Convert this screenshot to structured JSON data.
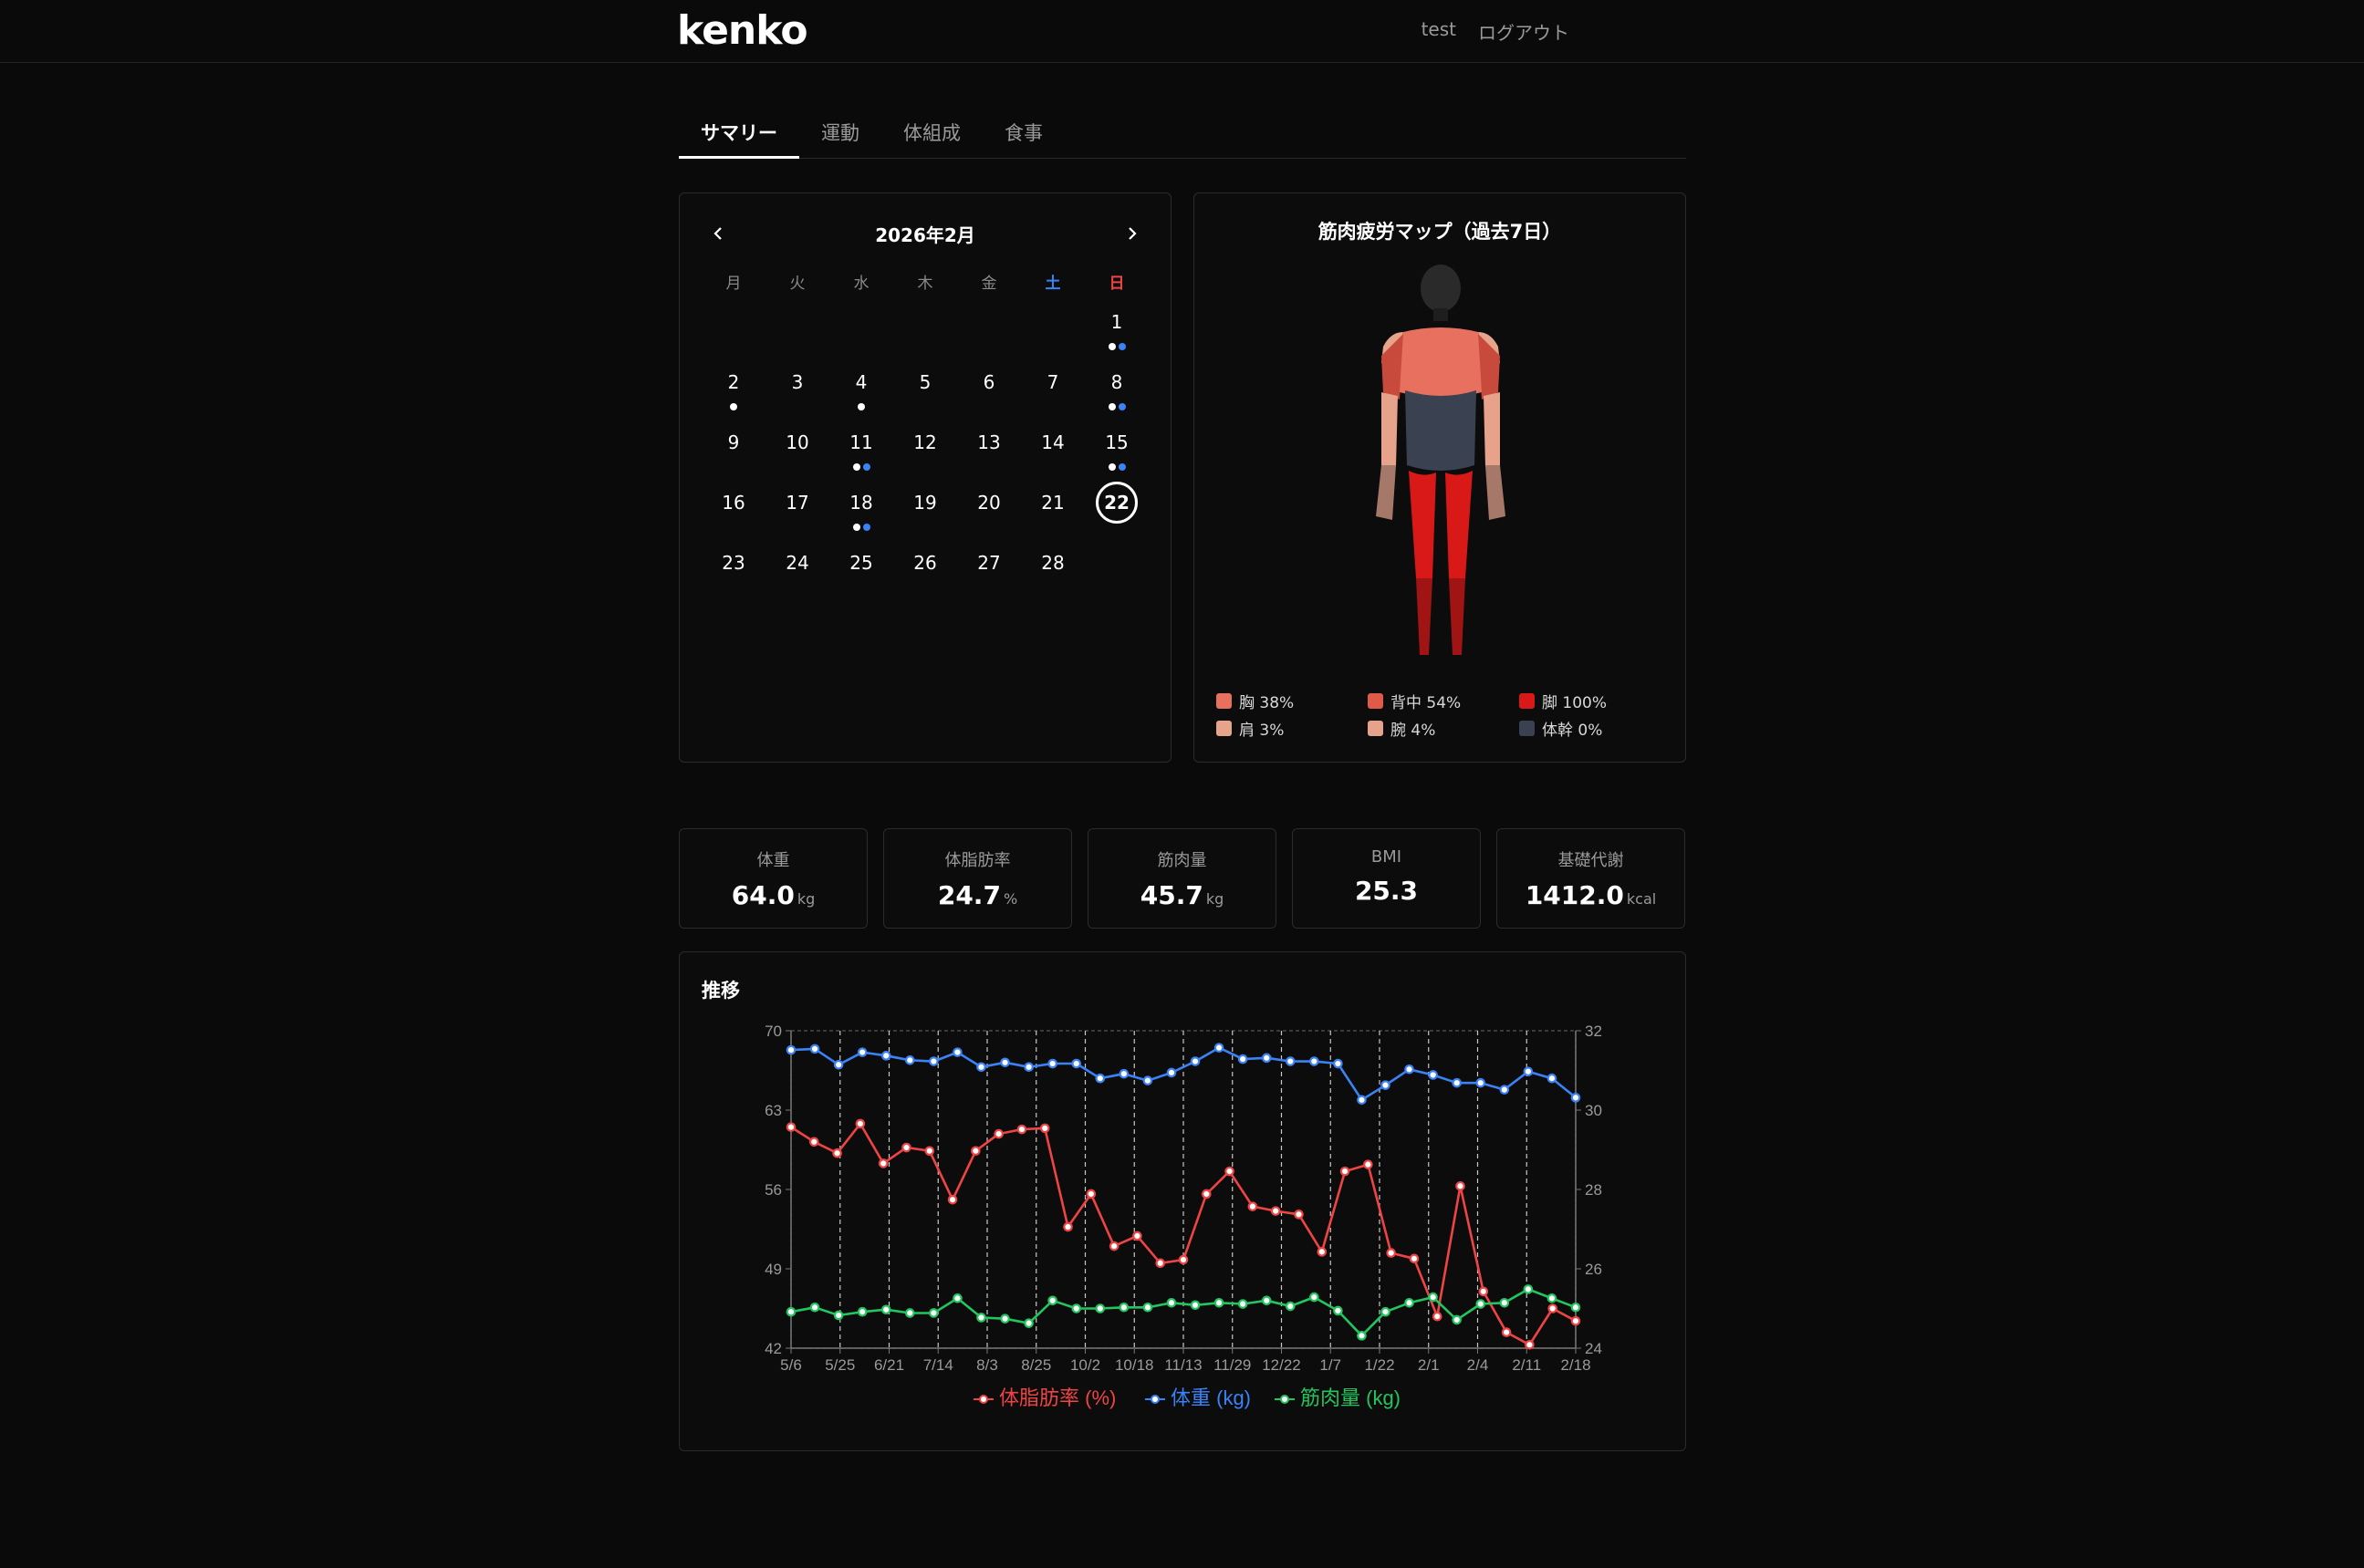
{
  "header": {
    "logo": "kenko",
    "username": "test",
    "logout_label": "ログアウト"
  },
  "tabs": [
    {
      "label": "サマリー",
      "active": true
    },
    {
      "label": "運動",
      "active": false
    },
    {
      "label": "体組成",
      "active": false
    },
    {
      "label": "食事",
      "active": false
    }
  ],
  "calendar": {
    "title": "2026年2月",
    "weekdays": [
      "月",
      "火",
      "水",
      "木",
      "金",
      "土",
      "日"
    ],
    "leading_blanks": 6,
    "days": [
      {
        "d": "1",
        "dots": [
          "white",
          "blue"
        ]
      },
      {
        "d": "2",
        "dots": [
          "white"
        ]
      },
      {
        "d": "3",
        "dots": []
      },
      {
        "d": "4",
        "dots": [
          "white"
        ]
      },
      {
        "d": "5",
        "dots": []
      },
      {
        "d": "6",
        "dots": []
      },
      {
        "d": "7",
        "dots": []
      },
      {
        "d": "8",
        "dots": [
          "white",
          "blue"
        ]
      },
      {
        "d": "9",
        "dots": []
      },
      {
        "d": "10",
        "dots": []
      },
      {
        "d": "11",
        "dots": [
          "white",
          "blue"
        ]
      },
      {
        "d": "12",
        "dots": []
      },
      {
        "d": "13",
        "dots": []
      },
      {
        "d": "14",
        "dots": []
      },
      {
        "d": "15",
        "dots": [
          "white",
          "blue"
        ]
      },
      {
        "d": "16",
        "dots": []
      },
      {
        "d": "17",
        "dots": []
      },
      {
        "d": "18",
        "dots": [
          "white",
          "blue"
        ]
      },
      {
        "d": "19",
        "dots": []
      },
      {
        "d": "20",
        "dots": []
      },
      {
        "d": "21",
        "dots": []
      },
      {
        "d": "22",
        "dots": [],
        "today": true
      },
      {
        "d": "23",
        "dots": []
      },
      {
        "d": "24",
        "dots": []
      },
      {
        "d": "25",
        "dots": []
      },
      {
        "d": "26",
        "dots": []
      },
      {
        "d": "27",
        "dots": []
      },
      {
        "d": "28",
        "dots": []
      }
    ]
  },
  "muscle_map": {
    "title": "筋肉疲労マップ（過去7日）",
    "legend": [
      {
        "label": "胸 38%",
        "color": "#e8705e"
      },
      {
        "label": "背中 54%",
        "color": "#e05a48"
      },
      {
        "label": "脚 100%",
        "color": "#d91818"
      },
      {
        "label": "肩 3%",
        "color": "#e7a48c"
      },
      {
        "label": "腕 4%",
        "color": "#e6a28a"
      },
      {
        "label": "体幹 0%",
        "color": "#3a4252"
      }
    ],
    "colors": {
      "chest": "#e8705e",
      "back": "#c84a3c",
      "legs": "#d91818",
      "shoulders": "#e7a48c",
      "arms": "#e6a28a",
      "core": "#3a4252",
      "head": "#2a2a2a"
    }
  },
  "stats": [
    {
      "label": "体重",
      "value": "64.0",
      "unit": "kg"
    },
    {
      "label": "体脂肪率",
      "value": "24.7",
      "unit": "%"
    },
    {
      "label": "筋肉量",
      "value": "45.7",
      "unit": "kg"
    },
    {
      "label": "BMI",
      "value": "25.3",
      "unit": ""
    },
    {
      "label": "基礎代謝",
      "value": "1412.0",
      "unit": "kcal"
    }
  ],
  "trend": {
    "title": "推移",
    "chart_data": {
      "type": "line",
      "x_ticks": [
        "5/6",
        "5/25",
        "6/21",
        "7/14",
        "8/3",
        "8/25",
        "10/2",
        "10/18",
        "11/13",
        "11/29",
        "12/22",
        "1/7",
        "1/22",
        "2/1",
        "2/4",
        "2/11",
        "2/18"
      ],
      "y_left": {
        "ticks": [
          "70",
          "63",
          "56",
          "49",
          "42"
        ],
        "range": [
          42,
          70
        ]
      },
      "y_right": {
        "ticks": [
          "32",
          "30",
          "28",
          "26",
          "24"
        ],
        "range": [
          24,
          32
        ]
      },
      "grid": "dashed vertical lines",
      "legend_position": "bottom",
      "series": [
        {
          "name": "体脂肪率 (%)",
          "color": "#ef4444",
          "axis": "left",
          "values": [
            61.5,
            60.2,
            59.2,
            61.8,
            58.3,
            59.7,
            59.4,
            55.1,
            59.4,
            60.9,
            61.3,
            61.4,
            52.7,
            55.6,
            51.0,
            51.9,
            49.5,
            49.8,
            55.6,
            57.6,
            54.5,
            54.1,
            53.8,
            50.5,
            57.6,
            58.2,
            50.4,
            49.9,
            44.8,
            56.3,
            47.0,
            43.4,
            42.3,
            45.5,
            44.4
          ]
        },
        {
          "name": "体重 (kg)",
          "color": "#3b82f6",
          "axis": "left",
          "values": [
            68.3,
            68.4,
            67.0,
            68.1,
            67.8,
            67.4,
            67.3,
            68.1,
            66.8,
            67.2,
            66.8,
            67.1,
            67.1,
            65.8,
            66.2,
            65.6,
            66.3,
            67.3,
            68.5,
            67.5,
            67.6,
            67.3,
            67.3,
            67.1,
            63.9,
            65.2,
            66.6,
            66.1,
            65.4,
            65.4,
            64.8,
            66.4,
            65.8,
            64.1
          ]
        },
        {
          "name": "筋肉量 (kg)",
          "color": "#22c55e",
          "axis": "left",
          "values": [
            45.2,
            45.6,
            44.9,
            45.2,
            45.4,
            45.1,
            45.1,
            46.4,
            44.7,
            44.6,
            44.2,
            46.2,
            45.5,
            45.5,
            45.6,
            45.6,
            46.0,
            45.8,
            46.0,
            45.9,
            46.2,
            45.7,
            46.5,
            45.3,
            43.1,
            45.2,
            46.0,
            46.5,
            44.5,
            45.9,
            46.0,
            47.2,
            46.4,
            45.6
          ]
        }
      ]
    }
  }
}
